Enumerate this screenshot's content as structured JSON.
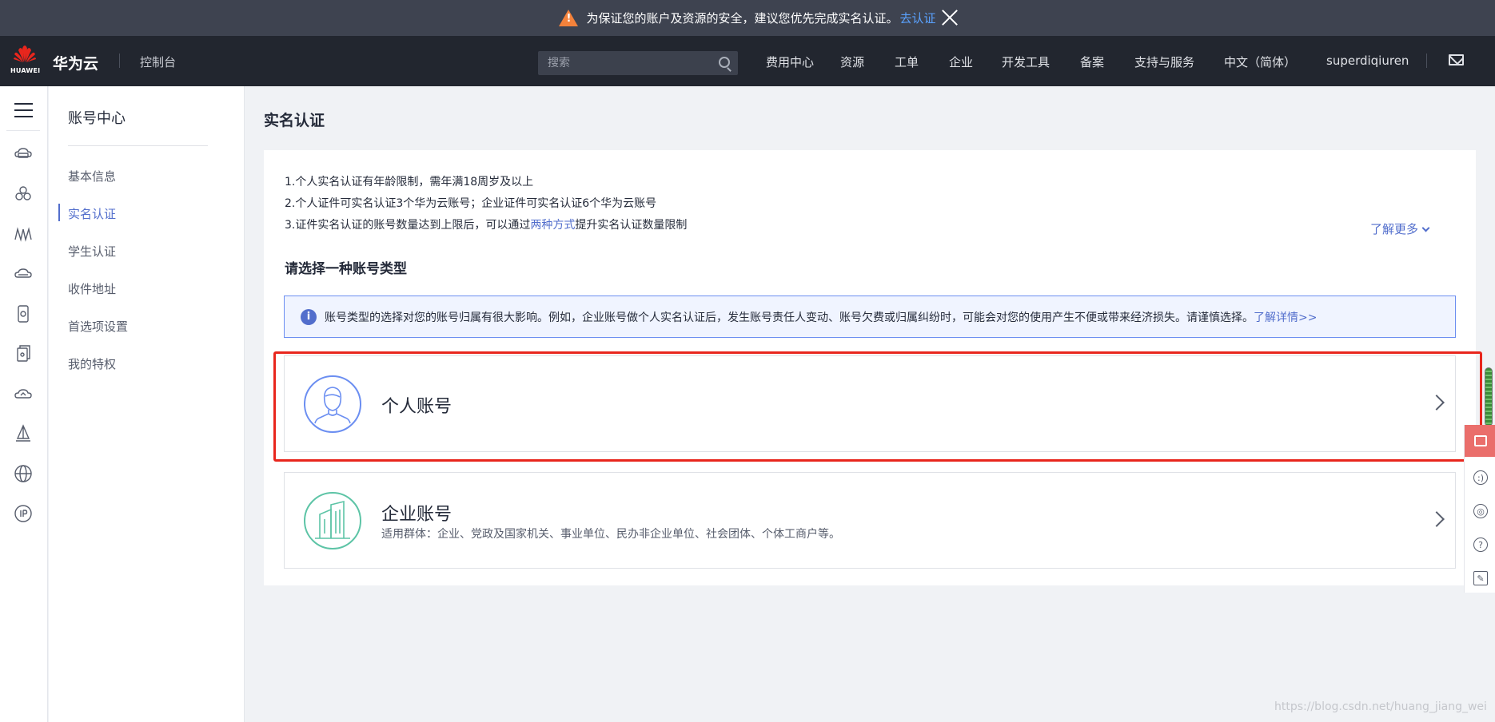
{
  "notice": {
    "text": "为保证您的账户及资源的安全，建议您优先完成实名认证。",
    "link": "去认证"
  },
  "topbar": {
    "logo_text": "HUAWEI",
    "brand": "华为云",
    "console": "控制台",
    "search_placeholder": "搜索",
    "nav": [
      "费用中心",
      "资源",
      "工单",
      "企业",
      "开发工具",
      "备案",
      "支持与服务",
      "中文（简体）",
      "superdiqiuren"
    ]
  },
  "rail": {
    "icons": [
      "cloud-server-icon",
      "cluster-icon",
      "network-icon",
      "storage-icon",
      "device-icon",
      "files-icon",
      "cloud-icon",
      "sail-icon",
      "globe-icon",
      "ip-icon"
    ]
  },
  "subnav": {
    "title": "账号中心",
    "items": [
      "基本信息",
      "实名认证",
      "学生认证",
      "收件地址",
      "首选项设置",
      "我的特权"
    ],
    "active_index": 1
  },
  "main": {
    "title": "实名认证",
    "rules": {
      "r1": "1.个人实名认证有年龄限制，需年满18周岁及以上",
      "r2": "2.个人证件可实名认证3个华为云账号；企业证件可实名认证6个华为云账号",
      "r3_pre": "3.证件实名认证的账号数量达到上限后，可以通过",
      "r3_link": "两种方式",
      "r3_post": "提升实名认证数量限制"
    },
    "learn_more": "了解更多",
    "choose_title": "请选择一种账号类型",
    "info_text": "账号类型的选择对您的账号归属有很大影响。例如，企业账号做个人实名认证后，发生账号责任人变动、账号欠费或归属纠纷时，可能会对您的使用产生不便或带来经济损失。请谨慎选择。",
    "info_link": "了解详情>>",
    "personal": {
      "title": "个人账号"
    },
    "enterprise": {
      "title": "企业账号",
      "subtitle": "适用群体：企业、党政及国家机关、事业单位、民办非企业单位、社会团体、个体工商户等。"
    }
  },
  "floatbar": {
    "help_glyph": "?"
  },
  "watermark": "https://blog.csdn.net/huang_jiang_wei",
  "colors": {
    "accent": "#526ecc",
    "highlight": "#e8261d",
    "topbar": "#22262f",
    "notice_bar": "#3e4350",
    "warning": "#f4823b"
  }
}
